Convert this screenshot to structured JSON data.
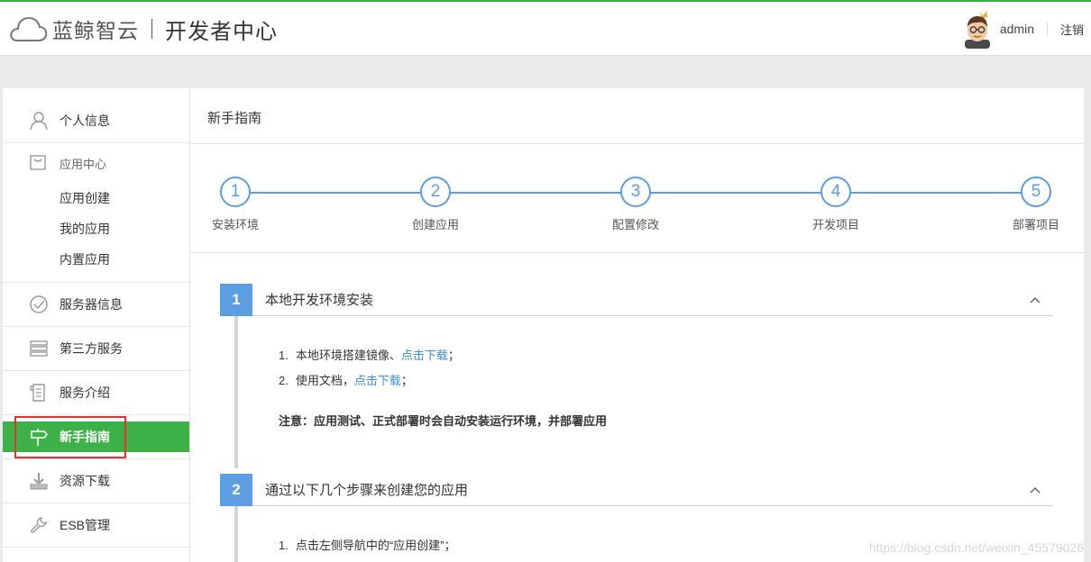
{
  "header": {
    "brand": "蓝鲸智云",
    "subtitle": "开发者中心",
    "username": "admin",
    "logout": "注销"
  },
  "sidebar": {
    "personal": "个人信息",
    "app_center": {
      "label": "应用中心",
      "items": [
        "应用创建",
        "我的应用",
        "内置应用"
      ]
    },
    "server_info": "服务器信息",
    "third_party": "第三方服务",
    "service_intro": "服务介绍",
    "guide": "新手指南",
    "downloads": "资源下载",
    "esb": "ESB管理"
  },
  "main": {
    "title": "新手指南",
    "steps": [
      {
        "num": "1",
        "label": "安装环境"
      },
      {
        "num": "2",
        "label": "创建应用"
      },
      {
        "num": "3",
        "label": "配置修改"
      },
      {
        "num": "4",
        "label": "开发项目"
      },
      {
        "num": "5",
        "label": "部署项目"
      }
    ],
    "sections": [
      {
        "num": "1",
        "title": "本地开发环境安装",
        "items": [
          {
            "num": "1.",
            "text": "本地环境搭建镜像、",
            "link": "点击下载",
            "suffix": "；"
          },
          {
            "num": "2.",
            "text": "使用文档，",
            "link": "点击下载",
            "suffix": "；"
          }
        ],
        "note": "注意：应用测试、正式部署时会自动安装运行环境，并部署应用"
      },
      {
        "num": "2",
        "title": "通过以下几个步骤来创建您的应用",
        "items": [
          {
            "num": "1.",
            "text": "点击左侧导航中的“应用创建”；"
          }
        ]
      }
    ]
  },
  "watermark": "https://blog.csdn.net/weixin_45579026",
  "colors": {
    "accent_green": "#3eb048",
    "step_blue": "#5b9ee1",
    "link_blue": "#3a8ee6",
    "highlight_red": "#e53232"
  }
}
